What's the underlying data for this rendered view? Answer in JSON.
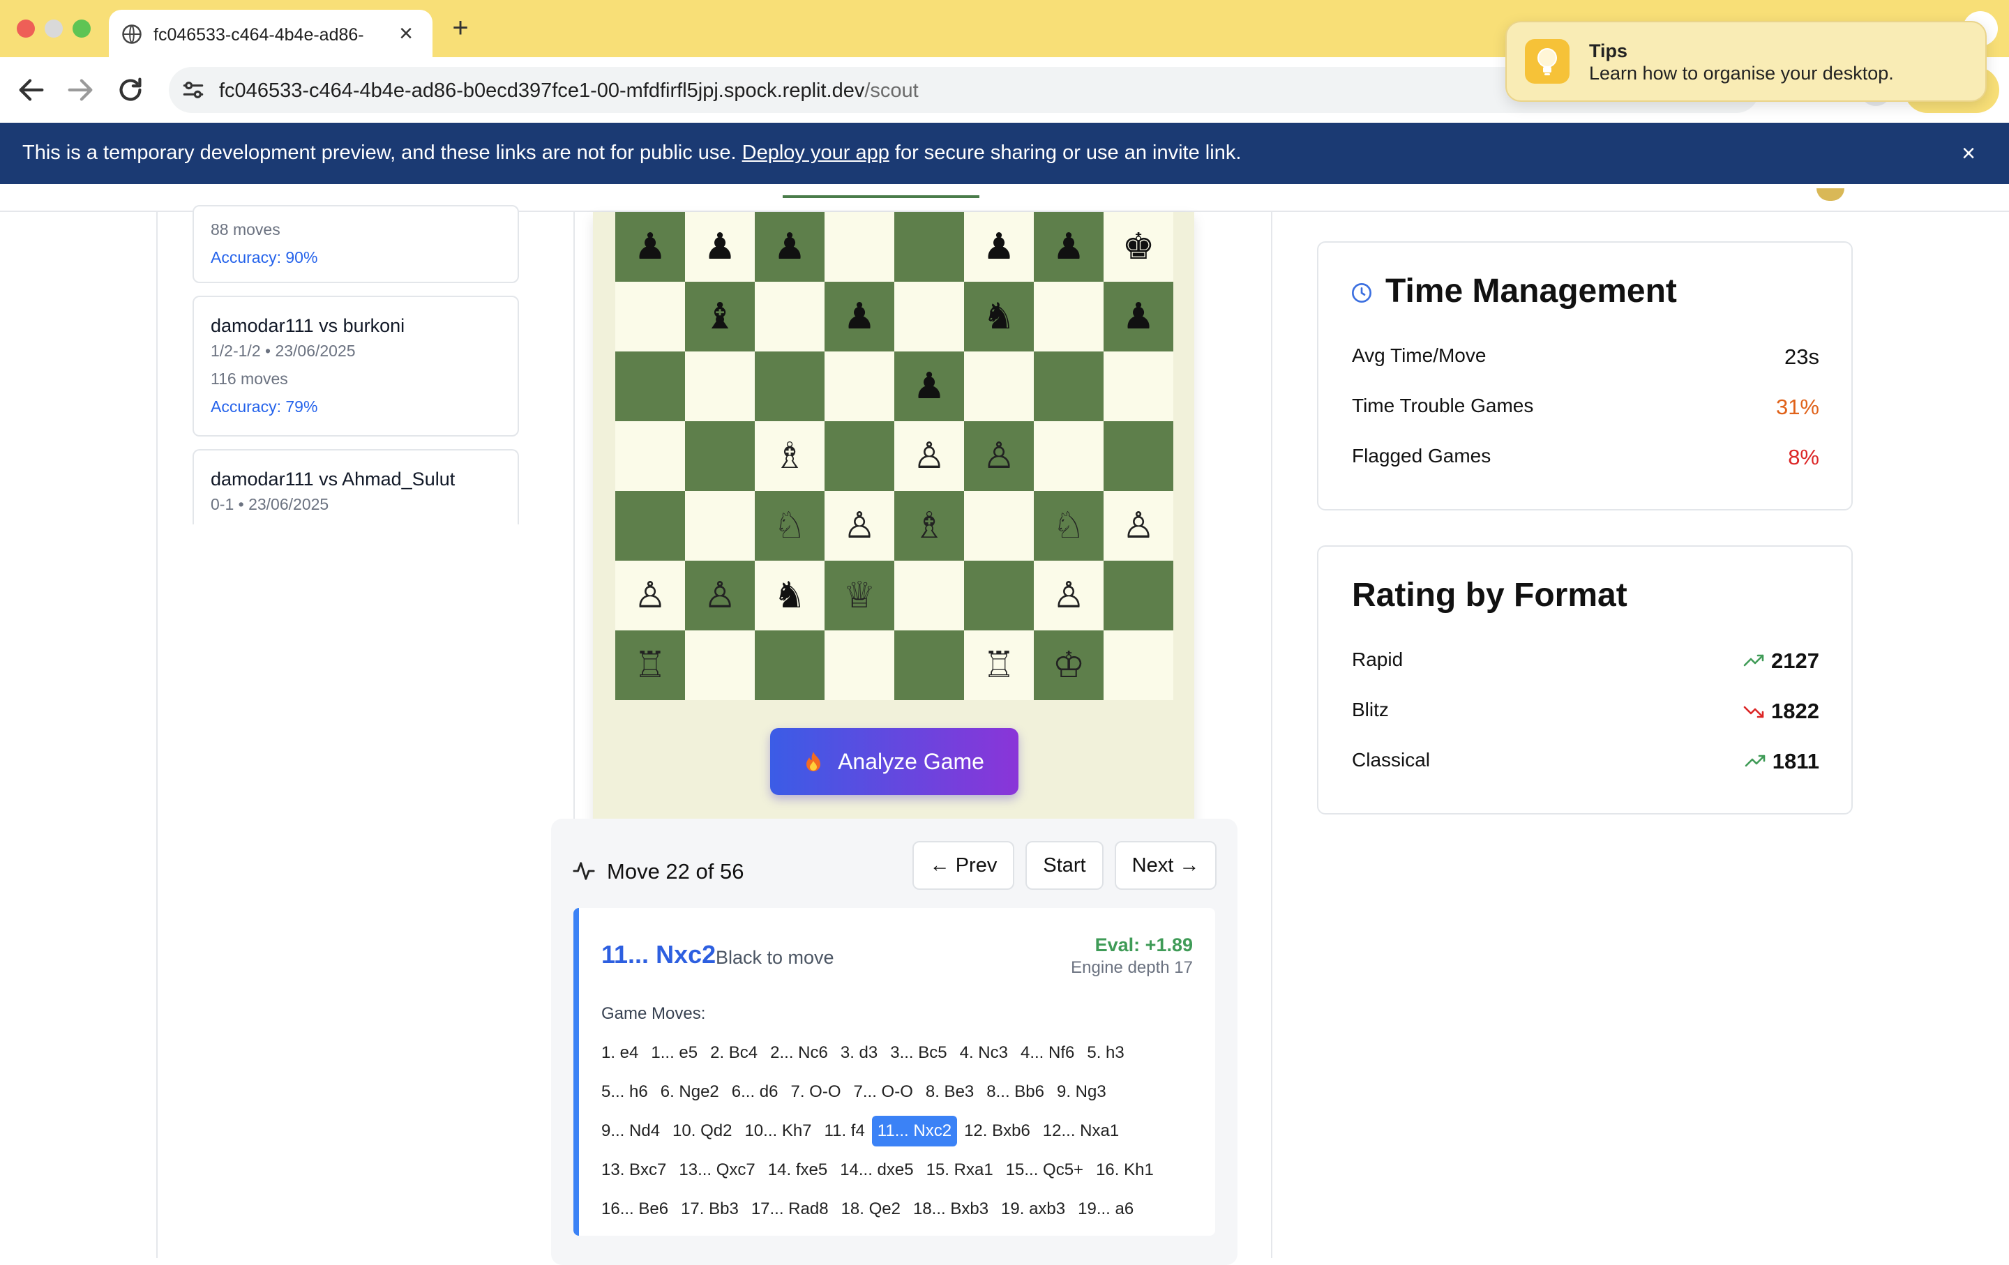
{
  "browser": {
    "tab_title": "fc046533-c464-4b4e-ad86-",
    "url_host": "fc046533-c464-4b4e-ad86-b0ecd397fce1-00-mfdfirfl5jpj.spock.replit.dev",
    "url_path": "/scout"
  },
  "notification": {
    "title": "Tips",
    "message": "Learn how to organise your desktop."
  },
  "banner": {
    "text_before": "This is a temporary development preview, and these links are not for public use.",
    "link": "Deploy your app",
    "text_after": "for secure sharing or use an invite link."
  },
  "games": [
    {
      "moves": "88 moves",
      "accuracy": "Accuracy: 90%"
    },
    {
      "title": "damodar111 vs burkoni",
      "result_date": "1/2-1/2 • 23/06/2025",
      "moves": "116 moves",
      "accuracy": "Accuracy: 79%"
    },
    {
      "title": "damodar111 vs Ahmad_Sulut",
      "result_date": "0-1 • 23/06/2025"
    }
  ],
  "board": {
    "colors": {
      "light": "#fbfbe9",
      "dark": "#5e7f4b"
    },
    "rows": [
      [
        "bp",
        "bp",
        "bp",
        "",
        "",
        "bp",
        "bp",
        "bk"
      ],
      [
        "",
        "bb",
        "",
        "bp",
        "",
        "bn",
        "",
        "bp"
      ],
      [
        "",
        "",
        "",
        "",
        "bp",
        "",
        "",
        ""
      ],
      [
        "",
        "",
        "wb",
        "",
        "wp",
        "wp",
        "",
        ""
      ],
      [
        "",
        "",
        "wn",
        "wp",
        "wb",
        "",
        "wn",
        "wp"
      ],
      [
        "wp",
        "wp",
        "bn",
        "wq",
        "",
        "",
        "wp",
        ""
      ],
      [
        "wr",
        "",
        "",
        "",
        "",
        "wr",
        "wk",
        ""
      ]
    ]
  },
  "analyze_button": "Analyze Game",
  "move_panel": {
    "counter": "Move 22 of 56",
    "prev": "← Prev",
    "start": "Start",
    "next": "Next →",
    "current_move": "11... Nxc2",
    "to_move": "Black to move",
    "eval": "Eval: +1.89",
    "depth": "Engine depth 17",
    "moves_label": "Game Moves:",
    "move_rows": [
      [
        "1. e4",
        "1... e5",
        "2. Bc4",
        "2... Nc6",
        "3. d3",
        "3... Bc5",
        "4. Nc3",
        "4... Nf6",
        "5. h3"
      ],
      [
        "5... h6",
        "6. Nge2",
        "6... d6",
        "7. O-O",
        "7... O-O",
        "8. Be3",
        "8... Bb6",
        "9. Ng3"
      ],
      [
        "9... Nd4",
        "10. Qd2",
        "10... Kh7",
        "11. f4",
        "11... Nxc2",
        "12. Bxb6",
        "12... Nxa1"
      ],
      [
        "13. Bxc7",
        "13... Qxc7",
        "14. fxe5",
        "14... dxe5",
        "15. Rxa1",
        "15... Qc5+",
        "16. Kh1"
      ],
      [
        "16... Be6",
        "17. Bb3",
        "17... Rad8",
        "18. Qe2",
        "18... Bxb3",
        "19. axb3",
        "19... a6"
      ]
    ],
    "active_move": "11... Nxc2"
  },
  "time_management": {
    "title": "Time Management",
    "rows": [
      {
        "label": "Avg Time/Move",
        "value": "23s",
        "color": "#111111"
      },
      {
        "label": "Time Trouble Games",
        "value": "31%",
        "color": "#e0621a"
      },
      {
        "label": "Flagged Games",
        "value": "8%",
        "color": "#dc2626"
      }
    ]
  },
  "rating_by_format": {
    "title": "Rating by Format",
    "rows": [
      {
        "label": "Rapid",
        "value": "2127",
        "trend": "up"
      },
      {
        "label": "Blitz",
        "value": "1822",
        "trend": "down"
      },
      {
        "label": "Classical",
        "value": "1811",
        "trend": "up"
      }
    ]
  }
}
